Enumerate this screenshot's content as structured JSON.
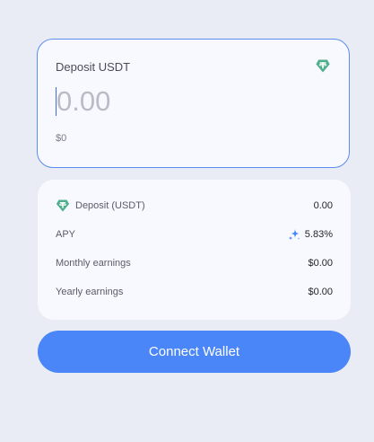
{
  "deposit": {
    "title": "Deposit USDT",
    "amount_placeholder": "0.00",
    "amount_value": "",
    "usd_value": "$0",
    "token_icon": "tether-icon"
  },
  "summary": {
    "rows": [
      {
        "label": "Deposit (USDT)",
        "value": "0.00",
        "icon": "tether-icon"
      },
      {
        "label": "APY",
        "value": "5.83%",
        "icon": "sparkle-icon"
      },
      {
        "label": "Monthly earnings",
        "value": "$0.00"
      },
      {
        "label": "Yearly earnings",
        "value": "$0.00"
      }
    ]
  },
  "actions": {
    "connect_label": "Connect Wallet"
  },
  "colors": {
    "background": "#e9ecf4",
    "card": "#f8f9fe",
    "accent": "#4a86f7",
    "tether_green": "#4fae8b",
    "focus_border": "#5b8def"
  }
}
